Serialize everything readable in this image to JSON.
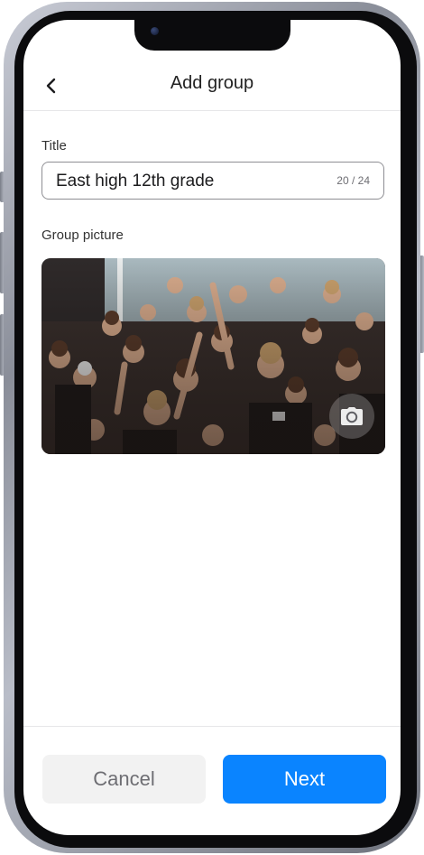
{
  "header": {
    "title": "Add group",
    "back_icon": "chevron-left-icon"
  },
  "form": {
    "title_label": "Title",
    "title_value": "East high 12th grade",
    "char_counter": "20 / 24",
    "picture_label": "Group picture",
    "picture_action_icon": "camera-icon"
  },
  "footer": {
    "cancel_label": "Cancel",
    "next_label": "Next"
  },
  "colors": {
    "primary": "#0a84ff",
    "secondary_button_bg": "#f2f2f2",
    "secondary_button_text": "#6e6e73",
    "input_border": "#8e8e93"
  }
}
